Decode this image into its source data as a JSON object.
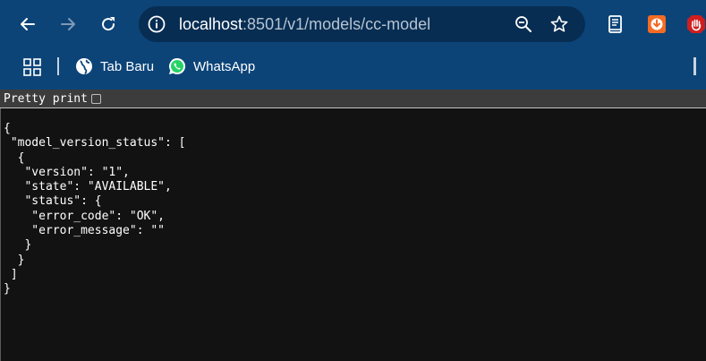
{
  "browser": {
    "url_host": "localhost",
    "url_rest": ":8501/v1/models/cc-model",
    "nav": {
      "back_icon": "arrow-left-icon",
      "forward_icon": "arrow-right-icon",
      "reload_icon": "reload-icon"
    },
    "omnibox_icons": [
      "site-info-icon",
      "zoom-icon",
      "bookmark-star-icon"
    ],
    "extensions": [
      "reading-list-icon",
      "download-extension-icon",
      "ublock-icon"
    ]
  },
  "bookmarks": {
    "apps_icon": "apps-grid-icon",
    "items": [
      {
        "label": "Tab Baru",
        "icon": "globe-icon"
      },
      {
        "label": "WhatsApp",
        "icon": "whatsapp-icon"
      }
    ]
  },
  "pretty_print": {
    "label": "Pretty print",
    "checked": false
  },
  "json_text": "{\n \"model_version_status\": [\n  {\n   \"version\": \"1\",\n   \"state\": \"AVAILABLE\",\n   \"status\": {\n    \"error_code\": \"OK\",\n    \"error_message\": \"\"\n   }\n  }\n ]\n}",
  "colors": {
    "toolbar": "#0c4478",
    "omnibox": "#072d52",
    "page_bg": "#121212",
    "pp_bar": "#3c3c3c"
  }
}
